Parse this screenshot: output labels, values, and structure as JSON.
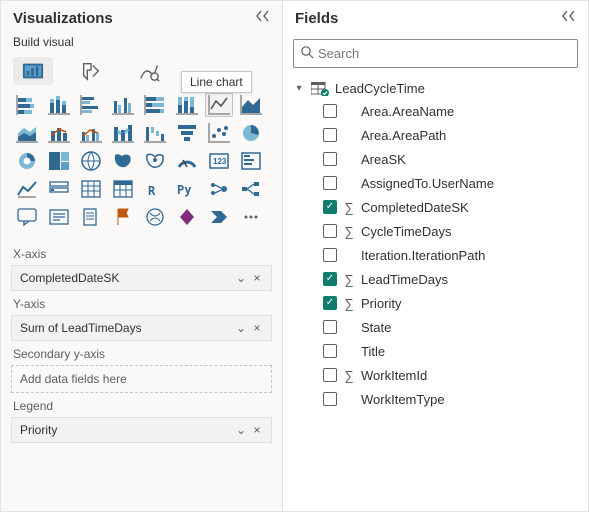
{
  "viz": {
    "title": "Visualizations",
    "build_label": "Build visual",
    "tooltip": "Line chart",
    "wells": {
      "xaxis_label": "X-axis",
      "xaxis_value": "CompletedDateSK",
      "yaxis_label": "Y-axis",
      "yaxis_value": "Sum of LeadTimeDays",
      "secondy_label": "Secondary y-axis",
      "secondy_placeholder": "Add data fields here",
      "legend_label": "Legend",
      "legend_value": "Priority"
    }
  },
  "fields": {
    "title": "Fields",
    "search_placeholder": "Search",
    "table": "LeadCycleTime",
    "items": [
      {
        "label": "Area.AreaName",
        "checked": false,
        "sigma": false
      },
      {
        "label": "Area.AreaPath",
        "checked": false,
        "sigma": false
      },
      {
        "label": "AreaSK",
        "checked": false,
        "sigma": false
      },
      {
        "label": "AssignedTo.UserName",
        "checked": false,
        "sigma": false
      },
      {
        "label": "CompletedDateSK",
        "checked": true,
        "sigma": true
      },
      {
        "label": "CycleTimeDays",
        "checked": false,
        "sigma": true
      },
      {
        "label": "Iteration.IterationPath",
        "checked": false,
        "sigma": false
      },
      {
        "label": "LeadTimeDays",
        "checked": true,
        "sigma": true
      },
      {
        "label": "Priority",
        "checked": true,
        "sigma": true
      },
      {
        "label": "State",
        "checked": false,
        "sigma": false
      },
      {
        "label": "Title",
        "checked": false,
        "sigma": false
      },
      {
        "label": "WorkItemId",
        "checked": false,
        "sigma": true
      },
      {
        "label": "WorkItemType",
        "checked": false,
        "sigma": false
      }
    ]
  }
}
